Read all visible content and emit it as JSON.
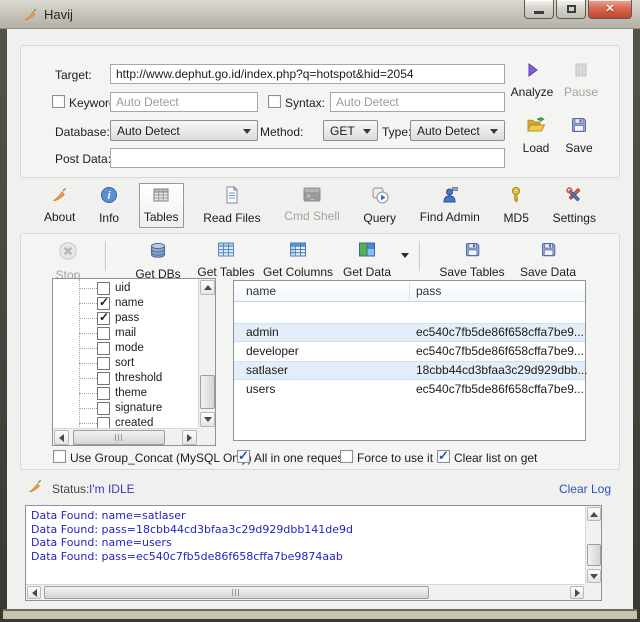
{
  "window": {
    "title": "Havij",
    "icon": "carrot-icon"
  },
  "target_form": {
    "target_label": "Target:",
    "target_value": "http://www.dephut.go.id/index.php?q=hotspot&hid=2054",
    "keyword_label": "Keyword:",
    "keyword_value": "Auto Detect",
    "keyword_checked": false,
    "syntax_label": "Syntax:",
    "syntax_value": "Auto Detect",
    "syntax_checked": false,
    "database_label": "Database:",
    "database_value": "Auto Detect",
    "method_label": "Method:",
    "method_value": "GET",
    "type_label": "Type:",
    "type_value": "Auto Detect",
    "post_data_label": "Post Data:",
    "post_data_value": "",
    "analyze_label": "Analyze",
    "pause_label": "Pause",
    "load_label": "Load",
    "save_label": "Save"
  },
  "main_toolbar": {
    "items": [
      {
        "label": "About",
        "icon": "carrot-icon",
        "state": "normal"
      },
      {
        "label": "Info",
        "icon": "info-icon",
        "state": "normal"
      },
      {
        "label": "Tables",
        "icon": "tables-icon",
        "state": "active"
      },
      {
        "label": "Read Files",
        "icon": "read-files-icon",
        "state": "normal"
      },
      {
        "label": "Cmd Shell",
        "icon": "terminal-icon",
        "state": "disabled"
      },
      {
        "label": "Query",
        "icon": "query-icon",
        "state": "normal"
      },
      {
        "label": "Find Admin",
        "icon": "find-admin-icon",
        "state": "normal"
      },
      {
        "label": "MD5",
        "icon": "key-icon",
        "state": "normal"
      },
      {
        "label": "Settings",
        "icon": "tools-icon",
        "state": "normal"
      }
    ]
  },
  "data_toolbar": {
    "items": [
      {
        "label": "Stop",
        "icon": "stop-icon",
        "state": "disabled"
      },
      {
        "label": "Get DBs",
        "icon": "database-icon",
        "state": "normal"
      },
      {
        "label": "Get Tables",
        "icon": "table-grid-icon",
        "state": "normal"
      },
      {
        "label": "Get Columns",
        "icon": "columns-grid-icon",
        "state": "normal"
      },
      {
        "label": "Get Data",
        "icon": "data-grid-icon",
        "state": "normal",
        "has_dropdown": true
      },
      {
        "label": "Save Tables",
        "icon": "floppy-icon",
        "state": "normal"
      },
      {
        "label": "Save Data",
        "icon": "floppy-icon",
        "state": "normal"
      }
    ]
  },
  "columns_tree": {
    "items": [
      {
        "label": "uid",
        "checked": false
      },
      {
        "label": "name",
        "checked": true
      },
      {
        "label": "pass",
        "checked": true
      },
      {
        "label": "mail",
        "checked": false
      },
      {
        "label": "mode",
        "checked": false
      },
      {
        "label": "sort",
        "checked": false
      },
      {
        "label": "threshold",
        "checked": false
      },
      {
        "label": "theme",
        "checked": false
      },
      {
        "label": "signature",
        "checked": false
      },
      {
        "label": "created",
        "checked": false
      }
    ]
  },
  "results_table": {
    "columns": [
      "name",
      "pass"
    ],
    "rows": [
      {
        "name": "admin",
        "pass": "ec540c7fb5de86f658cffa7be9..."
      },
      {
        "name": "developer",
        "pass": "ec540c7fb5de86f658cffa7be9..."
      },
      {
        "name": "satlaser",
        "pass": "18cbb44cd3bfaa3c29d929dbb..."
      },
      {
        "name": "users",
        "pass": "ec540c7fb5de86f658cffa7be9..."
      }
    ]
  },
  "options": {
    "checkboxes": [
      {
        "label": "Use Group_Concat (MySQL Only)",
        "checked": false
      },
      {
        "label": "All in one request.",
        "checked": true
      },
      {
        "label": "Force to use it",
        "checked": false
      },
      {
        "label": "Clear list on get",
        "checked": true
      }
    ]
  },
  "status_bar": {
    "icon": "carrot-icon",
    "label": "Status:",
    "value": "I'm IDLE",
    "clear_log": "Clear Log"
  },
  "log": {
    "lines": [
      "Data Found: name=satlaser",
      "Data Found: pass=18cbb44cd3bfaa3c29d929dbb141de9d",
      "Data Found: name=users",
      "Data Found: pass=ec540c7fb5de86f658cffa7be9874aab"
    ]
  },
  "colors": {
    "log_text": "#2323c8",
    "status_text": "#3a3ac0",
    "link": "#2b4fc0",
    "row_highlight": "#e2eefa",
    "analyze_accent": "#8060d8",
    "close_button": "#d96a50",
    "titlebar": "#c4c0b6"
  }
}
